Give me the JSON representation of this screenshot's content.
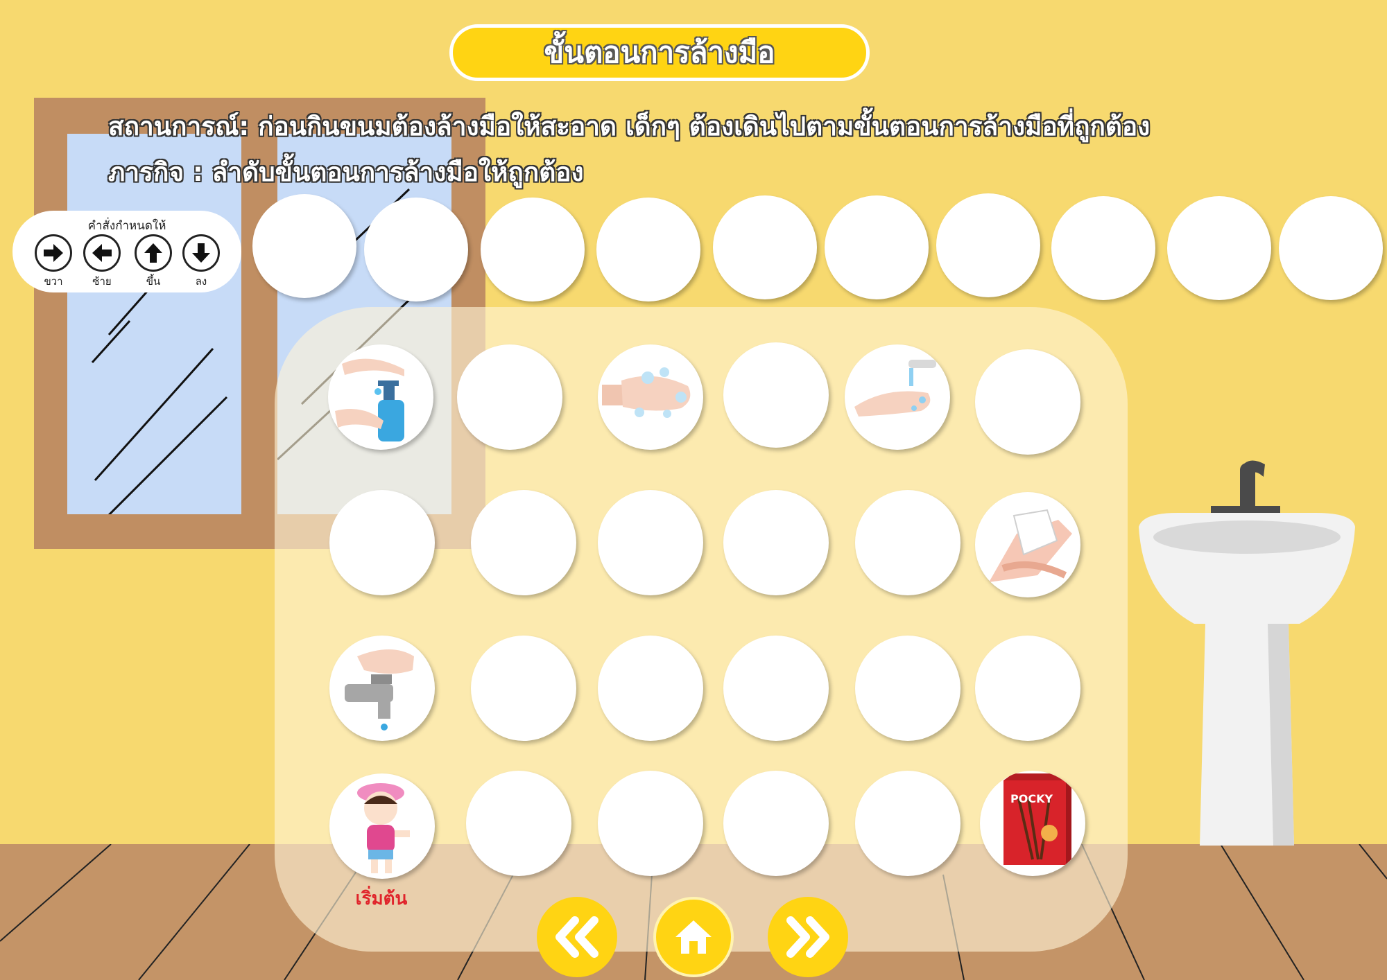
{
  "header": {
    "title": "ขั้นตอนการล้างมือ"
  },
  "scenario": {
    "line1": "สถานการณ์: ก่อนกินขนมต้องล้างมือให้สะอาด เด็กๆ ต้องเดินไปตามขั้นตอนการล้างมือที่ถูกต้อง",
    "line2": "ภารกิจ : ลำดับขั้นตอนการล้างมือให้ถูกต้อง"
  },
  "legend": {
    "title": "คำสั่งกำหนดให้",
    "commands": [
      {
        "label": "ขวา",
        "icon": "arrow-right-icon"
      },
      {
        "label": "ซ้าย",
        "icon": "arrow-left-icon"
      },
      {
        "label": "ขึ้น",
        "icon": "arrow-up-icon"
      },
      {
        "label": "ลง",
        "icon": "arrow-down-icon"
      }
    ]
  },
  "answer_slots": {
    "count": 10
  },
  "grid": {
    "rows": [
      [
        "hand-sanitizer-pump",
        "empty",
        "soap-lather-hands",
        "empty",
        "rinse-under-tap",
        "empty"
      ],
      [
        "empty",
        "empty",
        "empty",
        "empty",
        "empty",
        "dry-with-tissue"
      ],
      [
        "turn-on-faucet",
        "empty",
        "empty",
        "empty",
        "empty",
        "empty"
      ],
      [
        "girl-character",
        "empty",
        "empty",
        "empty",
        "empty",
        "pocky-snack-box"
      ]
    ],
    "start_label": "เริ่มต้น",
    "snack_label": "POCKY"
  },
  "nav": {
    "prev_icon": "double-chevron-left-icon",
    "home_icon": "home-icon",
    "next_icon": "double-chevron-right-icon"
  },
  "colors": {
    "wall": "#f7d96f",
    "floor": "#c49467",
    "title_bar": "#ffd413",
    "nav_button": "#ffd413",
    "start_text": "#e0242b"
  }
}
